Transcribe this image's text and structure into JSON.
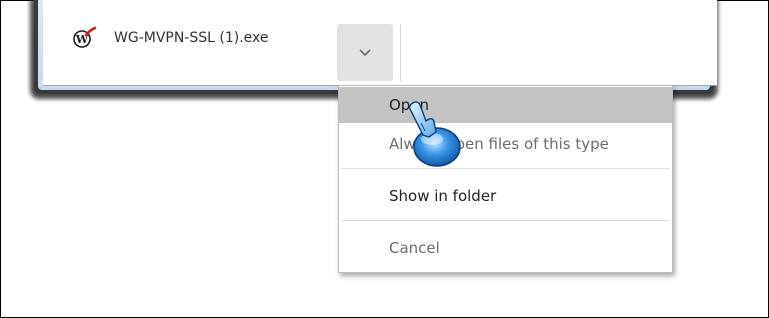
{
  "download": {
    "file_name": "WG-MVPN-SSL (1).exe",
    "icon": "watchguard-w-icon",
    "menu_button_icon": "chevron-down-icon"
  },
  "context_menu": {
    "items": [
      {
        "label": "Open",
        "state": "highlighted"
      },
      {
        "label": "Always open files of this type",
        "state": "disabled"
      },
      {
        "label": "Show in folder",
        "state": "normal"
      },
      {
        "label": "Cancel",
        "state": "disabled"
      }
    ]
  },
  "cursor": {
    "icon": "hand-pointer-click-icon"
  },
  "colors": {
    "highlight": "#c3c3c3",
    "shelf_border": "#3a3a3a",
    "shelf_inner": "#dfe8f4",
    "cursor_blue": "#2a7fd4"
  }
}
